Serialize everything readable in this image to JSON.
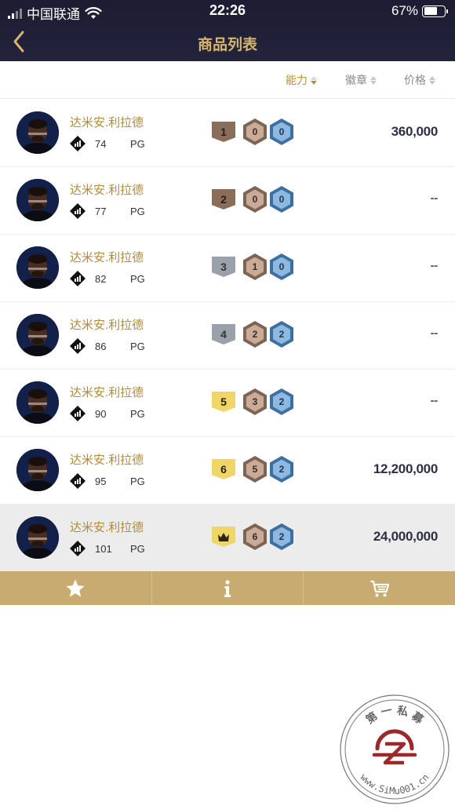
{
  "status_bar": {
    "carrier": "中国联通",
    "time": "22:26",
    "battery": "67%",
    "battery_level": 0.67
  },
  "nav": {
    "title": "商品列表",
    "back_icon": "chevron-left-icon"
  },
  "sort": {
    "ability": "能力",
    "badge": "徽章",
    "price": "价格",
    "active": "ability"
  },
  "players": [
    {
      "name": "达米安.利拉德",
      "rating": "74",
      "position": "PG",
      "level": "1",
      "level_style": "brown",
      "bronze": "0",
      "blue": "0",
      "price": "360,000"
    },
    {
      "name": "达米安.利拉德",
      "rating": "77",
      "position": "PG",
      "level": "2",
      "level_style": "brown",
      "bronze": "0",
      "blue": "0",
      "price": "--"
    },
    {
      "name": "达米安.利拉德",
      "rating": "82",
      "position": "PG",
      "level": "3",
      "level_style": "silver",
      "bronze": "1",
      "blue": "0",
      "price": "--"
    },
    {
      "name": "达米安.利拉德",
      "rating": "86",
      "position": "PG",
      "level": "4",
      "level_style": "silver",
      "bronze": "2",
      "blue": "2",
      "price": "--"
    },
    {
      "name": "达米安.利拉德",
      "rating": "90",
      "position": "PG",
      "level": "5",
      "level_style": "gold",
      "bronze": "3",
      "blue": "2",
      "price": "--"
    },
    {
      "name": "达米安.利拉德",
      "rating": "95",
      "position": "PG",
      "level": "6",
      "level_style": "gold",
      "bronze": "5",
      "blue": "2",
      "price": "12,200,000"
    },
    {
      "name": "达米安.利拉德",
      "rating": "101",
      "position": "PG",
      "level": "",
      "level_style": "gold",
      "bronze": "6",
      "blue": "2",
      "price": "24,000,000",
      "selected": true
    }
  ],
  "footer": {
    "buttons": [
      "star-icon",
      "info-icon",
      "cart-icon"
    ]
  },
  "watermark": {
    "text_top": "第 一 私 募",
    "text_bottom": "www.SiMu001.cn"
  },
  "colors": {
    "accent_gold": "#d6b46c",
    "name_gold": "#b08a3e",
    "footer_gold": "#c7ab71",
    "header_dark": "#1d1c33",
    "watermark_red": "#9a2a2a"
  }
}
